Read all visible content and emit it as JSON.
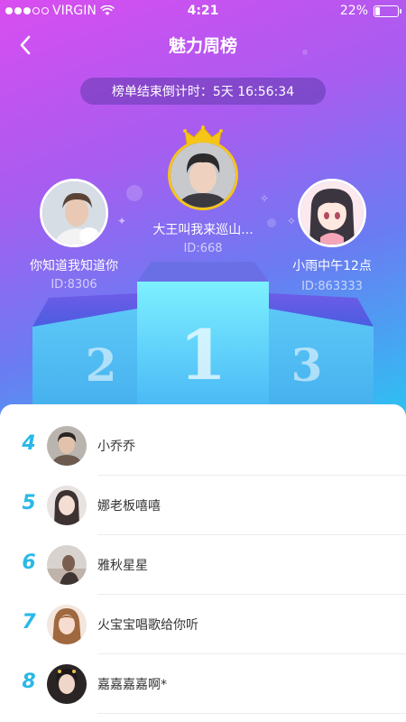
{
  "status_bar": {
    "carrier": "VIRGIN",
    "time": "4:21",
    "battery_text": "22%",
    "battery_level": 0.22,
    "signal_bars_filled": 3,
    "signal_bars_total": 5,
    "wifi_icon": "wifi-icon"
  },
  "nav": {
    "title": "魅力周榜",
    "back_icon": "chevron-left-icon"
  },
  "countdown": {
    "text": "榜单结束倒计时：5天 16:56:34"
  },
  "podium": {
    "first": {
      "rank": "1",
      "name": "大王叫我来巡山...",
      "id_text": "ID:668",
      "badge_icon": "crown-icon"
    },
    "second": {
      "rank": "2",
      "name": "你知道我知道你",
      "id_text": "ID:8306"
    },
    "third": {
      "rank": "3",
      "name": "小雨中午12点",
      "id_text": "ID:863333"
    }
  },
  "ranking_list": [
    {
      "rank": "4",
      "name": "小乔乔"
    },
    {
      "rank": "5",
      "name": "娜老板嘻嘻"
    },
    {
      "rank": "6",
      "name": "雅秋星星"
    },
    {
      "rank": "7",
      "name": "火宝宝唱歌给你听"
    },
    {
      "rank": "8",
      "name": "嘉嘉嘉嘉啊*"
    }
  ],
  "colors": {
    "gradient_top": "#d94df0",
    "gradient_bottom": "#2bc5f2",
    "rank_number": "#2ab8e8",
    "crown_gold": "#f5c518"
  }
}
